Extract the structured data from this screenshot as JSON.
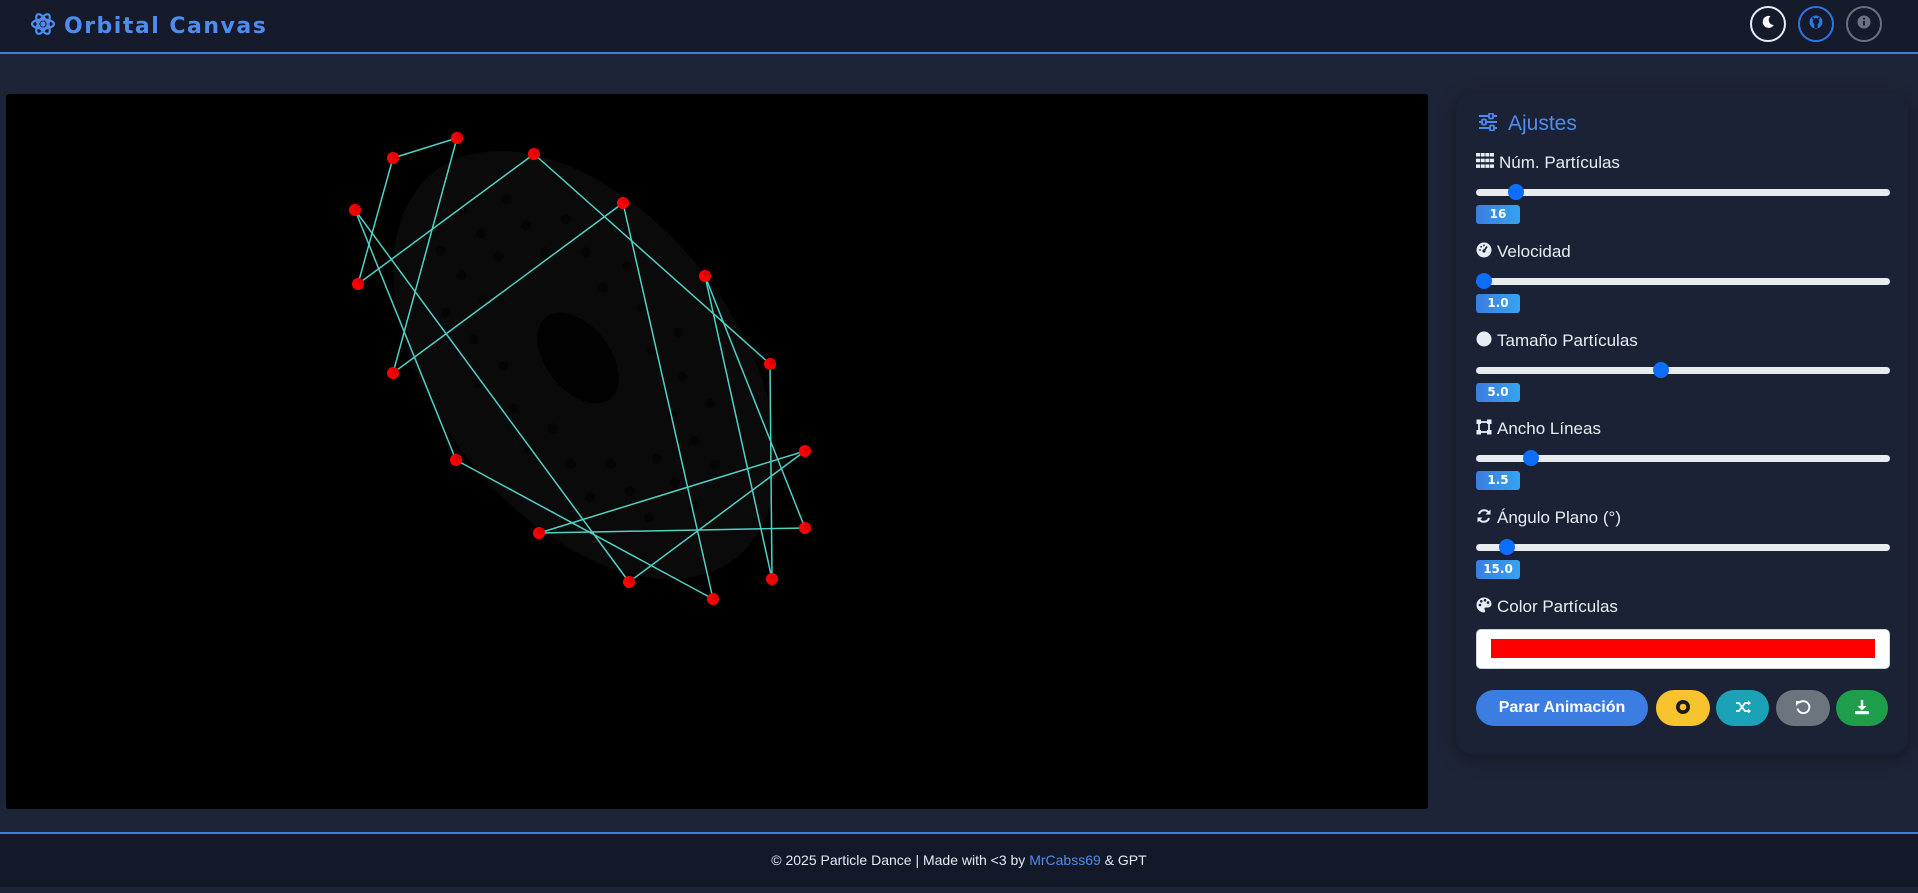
{
  "header": {
    "title": "Orbital Canvas",
    "logo_icon": "atom-icon",
    "buttons": [
      {
        "name": "theme-toggle",
        "icon": "moon-icon"
      },
      {
        "name": "github",
        "icon": "github-icon"
      },
      {
        "name": "info",
        "icon": "info-icon"
      }
    ]
  },
  "settings": {
    "title": "Ajustes",
    "title_icon": "sliders-icon",
    "particles": {
      "label": "Núm. Partículas",
      "value": "16",
      "fraction": 0.08,
      "icon": "grid-icon"
    },
    "speed": {
      "label": "Velocidad",
      "value": "1.0",
      "fraction": 0.0,
      "icon": "gauge-icon"
    },
    "size": {
      "label": "Tamaño Partículas",
      "value": "5.0",
      "fraction": 0.445,
      "icon": "circle-icon"
    },
    "line_width": {
      "label": "Ancho Líneas",
      "value": "1.5",
      "fraction": 0.118,
      "icon": "vector-square-icon"
    },
    "plane_angle": {
      "label": "Ángulo Plano (°)",
      "value": "15.0",
      "fraction": 0.057,
      "icon": "sync-icon"
    },
    "color": {
      "label": "Color Partículas",
      "value": "#ff0000",
      "icon": "palette-icon"
    },
    "actions": {
      "stop_label": "Parar Animación",
      "record_icon": "record-icon",
      "shuffle_icon": "shuffle-icon",
      "reset_icon": "undo-icon",
      "download_icon": "download-icon"
    }
  },
  "canvas": {
    "background": "#000000",
    "particle_color": "#ff0000",
    "line_color": "#4fd1c5",
    "particle_count": 16
  },
  "footer": {
    "text_before": "© 2025 Particle Dance | Made with <3 by ",
    "link_text": "MrCabss69",
    "text_after": " & GPT"
  },
  "colors": {
    "accent": "#3b7de0",
    "background": "#1e2437",
    "panel": "#1b2236"
  }
}
